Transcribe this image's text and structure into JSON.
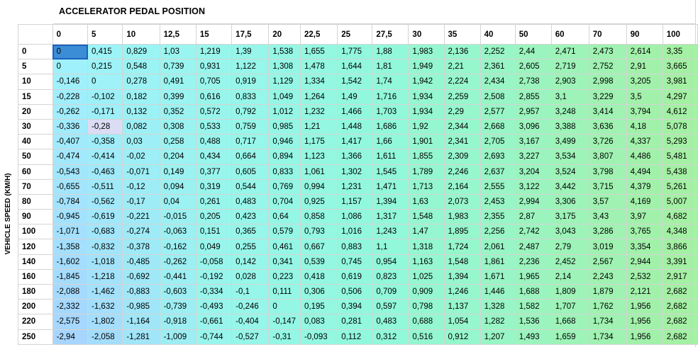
{
  "header": {
    "title": "ACCELERATOR PEDAL POSITION"
  },
  "side": {
    "label": "VEHICLE SPEED (KM/H)"
  },
  "table": {
    "columns": [
      "0",
      "5",
      "10",
      "12,5",
      "15",
      "17,5",
      "20",
      "22,5",
      "25",
      "27,5",
      "30",
      "35",
      "40",
      "50",
      "60",
      "70",
      "90",
      "100"
    ],
    "rows": [
      {
        "label": "0",
        "values": [
          "0",
          "0,415",
          "0,829",
          "1,03",
          "1,219",
          "1,39",
          "1,538",
          "1,655",
          "1,775",
          "1,88",
          "1,983",
          "2,136",
          "2,252",
          "2,44",
          "2,471",
          "2,473",
          "2,614",
          "3,35"
        ]
      },
      {
        "label": "5",
        "values": [
          "0",
          "0,215",
          "0,548",
          "0,739",
          "0,931",
          "1,122",
          "1,308",
          "1,478",
          "1,644",
          "1,81",
          "1,949",
          "2,21",
          "2,361",
          "2,605",
          "2,719",
          "2,752",
          "2,91",
          "3,665"
        ]
      },
      {
        "label": "10",
        "values": [
          "-0,146",
          "0",
          "0,278",
          "0,491",
          "0,705",
          "0,919",
          "1,129",
          "1,334",
          "1,542",
          "1,74",
          "1,942",
          "2,224",
          "2,434",
          "2,738",
          "2,903",
          "2,998",
          "3,205",
          "3,981"
        ]
      },
      {
        "label": "15",
        "values": [
          "-0,228",
          "-0,102",
          "0,182",
          "0,399",
          "0,616",
          "0,833",
          "1,049",
          "1,264",
          "1,49",
          "1,716",
          "1,934",
          "2,259",
          "2,508",
          "2,855",
          "3,1",
          "3,229",
          "3,5",
          "4,297"
        ]
      },
      {
        "label": "20",
        "values": [
          "-0,262",
          "-0,171",
          "0,132",
          "0,352",
          "0,572",
          "0,792",
          "1,012",
          "1,232",
          "1,466",
          "1,703",
          "1,934",
          "2,29",
          "2,577",
          "2,957",
          "3,248",
          "3,414",
          "3,794",
          "4,612"
        ]
      },
      {
        "label": "30",
        "values": [
          "-0,336",
          "-0,28",
          "0,082",
          "0,308",
          "0,533",
          "0,759",
          "0,985",
          "1,21",
          "1,448",
          "1,686",
          "1,92",
          "2,344",
          "2,668",
          "3,096",
          "3,388",
          "3,636",
          "4,18",
          "5,078"
        ]
      },
      {
        "label": "40",
        "values": [
          "-0,407",
          "-0,358",
          "0,03",
          "0,258",
          "0,488",
          "0,717",
          "0,946",
          "1,175",
          "1,417",
          "1,66",
          "1,901",
          "2,341",
          "2,705",
          "3,167",
          "3,499",
          "3,726",
          "4,337",
          "5,293"
        ]
      },
      {
        "label": "50",
        "values": [
          "-0,474",
          "-0,414",
          "-0,02",
          "0,204",
          "0,434",
          "0,664",
          "0,894",
          "1,123",
          "1,366",
          "1,611",
          "1,855",
          "2,309",
          "2,693",
          "3,227",
          "3,534",
          "3,807",
          "4,486",
          "5,481"
        ]
      },
      {
        "label": "60",
        "values": [
          "-0,543",
          "-0,463",
          "-0,071",
          "0,149",
          "0,377",
          "0,605",
          "0,833",
          "1,061",
          "1,302",
          "1,545",
          "1,789",
          "2,246",
          "2,637",
          "3,204",
          "3,524",
          "3,798",
          "4,494",
          "5,438"
        ]
      },
      {
        "label": "70",
        "values": [
          "-0,655",
          "-0,511",
          "-0,12",
          "0,094",
          "0,319",
          "0,544",
          "0,769",
          "0,994",
          "1,231",
          "1,471",
          "1,713",
          "2,164",
          "2,555",
          "3,122",
          "3,442",
          "3,715",
          "4,379",
          "5,261"
        ]
      },
      {
        "label": "80",
        "values": [
          "-0,784",
          "-0,562",
          "-0,17",
          "0,04",
          "0,261",
          "0,483",
          "0,704",
          "0,925",
          "1,157",
          "1,394",
          "1,63",
          "2,073",
          "2,453",
          "2,994",
          "3,306",
          "3,57",
          "4,169",
          "5,007"
        ]
      },
      {
        "label": "90",
        "values": [
          "-0,945",
          "-0,619",
          "-0,221",
          "-0,015",
          "0,205",
          "0,423",
          "0,64",
          "0,858",
          "1,086",
          "1,317",
          "1,548",
          "1,983",
          "2,355",
          "2,87",
          "3,175",
          "3,43",
          "3,97",
          "4,682"
        ]
      },
      {
        "label": "100",
        "values": [
          "-1,071",
          "-0,683",
          "-0,274",
          "-0,063",
          "0,151",
          "0,365",
          "0,579",
          "0,793",
          "1,016",
          "1,243",
          "1,47",
          "1,895",
          "2,256",
          "2,742",
          "3,043",
          "3,286",
          "3,765",
          "4,348"
        ]
      },
      {
        "label": "120",
        "values": [
          "-1,358",
          "-0,832",
          "-0,378",
          "-0,162",
          "0,049",
          "0,255",
          "0,461",
          "0,667",
          "0,883",
          "1,1",
          "1,318",
          "1,724",
          "2,061",
          "2,487",
          "2,79",
          "3,019",
          "3,354",
          "3,866"
        ]
      },
      {
        "label": "140",
        "values": [
          "-1,602",
          "-1,018",
          "-0,485",
          "-0,262",
          "-0,058",
          "0,142",
          "0,341",
          "0,539",
          "0,745",
          "0,954",
          "1,163",
          "1,548",
          "1,861",
          "2,236",
          "2,452",
          "2,567",
          "2,944",
          "3,391"
        ]
      },
      {
        "label": "160",
        "values": [
          "-1,845",
          "-1,218",
          "-0,692",
          "-0,441",
          "-0,192",
          "0,028",
          "0,223",
          "0,418",
          "0,619",
          "0,823",
          "1,025",
          "1,394",
          "1,671",
          "1,965",
          "2,14",
          "2,243",
          "2,532",
          "2,917"
        ]
      },
      {
        "label": "180",
        "values": [
          "-2,088",
          "-1,462",
          "-0,883",
          "-0,603",
          "-0,334",
          "-0,1",
          "0,111",
          "0,306",
          "0,506",
          "0,709",
          "0,909",
          "1,246",
          "1,446",
          "1,688",
          "1,809",
          "1,879",
          "2,121",
          "2,682"
        ]
      },
      {
        "label": "200",
        "values": [
          "-2,332",
          "-1,632",
          "-0,985",
          "-0,739",
          "-0,493",
          "-0,246",
          "0",
          "0,195",
          "0,394",
          "0,597",
          "0,798",
          "1,137",
          "1,328",
          "1,582",
          "1,707",
          "1,762",
          "1,956",
          "2,682"
        ]
      },
      {
        "label": "220",
        "values": [
          "-2,575",
          "-1,802",
          "-1,164",
          "-0,918",
          "-0,661",
          "-0,404",
          "-0,147",
          "0,083",
          "0,281",
          "0,483",
          "0,688",
          "1,054",
          "1,282",
          "1,536",
          "1,668",
          "1,734",
          "1,956",
          "2,682"
        ]
      },
      {
        "label": "250",
        "values": [
          "-2,94",
          "-2,058",
          "-1,281",
          "-1,009",
          "-0,744",
          "-0,527",
          "-0,31",
          "-0,093",
          "0,112",
          "0,312",
          "0,516",
          "0,912",
          "1,207",
          "1,493",
          "1,659",
          "1,734",
          "1,956",
          "2,682"
        ]
      }
    ],
    "bold_from_column": 8,
    "selected_cell": {
      "row": 0,
      "col": 0
    },
    "highlight_cell": {
      "row": 5,
      "col": 1,
      "color": "#dcdcf5"
    }
  },
  "colors": {
    "grid_line": "#d4d4d4",
    "cell_left": "#9ff3fb",
    "cell_mid": "#90f8dc",
    "cell_right": "#a4f0a4",
    "cell_low": "#a8d0ff",
    "selected_fill": "#3b8ed6"
  }
}
